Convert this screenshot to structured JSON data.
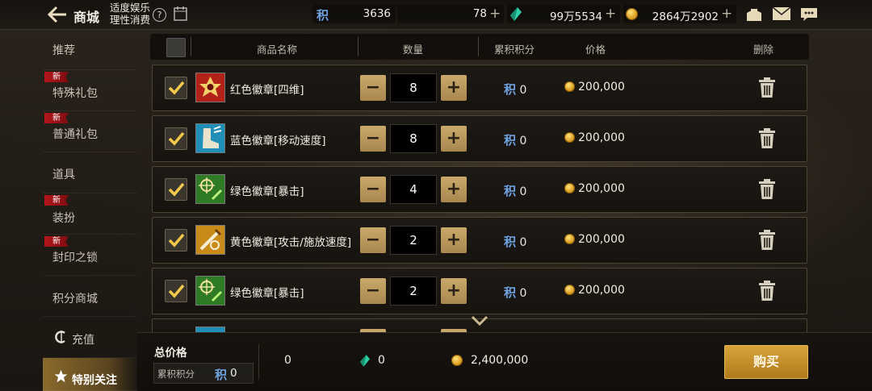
{
  "topbar": {
    "shop_title": "商城",
    "notice_line1": "适度娱乐",
    "notice_line2": "理性消费",
    "help_label": "?",
    "calendar_label": "关",
    "jifen_glyph": "积",
    "currencies": {
      "points": "3636",
      "c_glyph": "₵",
      "c_coins": "78",
      "gems": "99万5534",
      "gold": "2864万2902"
    },
    "plus_label": "+"
  },
  "sidebar": {
    "new_badge": "新",
    "items": [
      {
        "label": "推荐",
        "is_new": false,
        "active": false
      },
      {
        "label": "特殊礼包",
        "is_new": true,
        "active": false
      },
      {
        "label": "普通礼包",
        "is_new": true,
        "active": false
      },
      {
        "label": "道具",
        "is_new": false,
        "active": false
      },
      {
        "label": "装扮",
        "is_new": true,
        "active": false
      },
      {
        "label": "封印之锁",
        "is_new": true,
        "active": false
      },
      {
        "label": "积分商城",
        "is_new": false,
        "active": false
      },
      {
        "label": "充值",
        "is_new": false,
        "active": false,
        "icon": "c-coin-icon"
      },
      {
        "label": "特别关注",
        "is_new": false,
        "active": true,
        "icon": "star-icon"
      }
    ]
  },
  "table": {
    "headers": {
      "name": "商品名称",
      "quantity": "数量",
      "points": "累积积分",
      "price": "价格",
      "delete": "删除"
    },
    "minus_label": "−",
    "plus_label": "+",
    "rows": [
      {
        "name": "红色徽章[四维]",
        "qty": "8",
        "points": "0",
        "price": "200,000",
        "checked": true,
        "icon": "red-emblem-icon"
      },
      {
        "name": "蓝色徽章[移动速度]",
        "qty": "8",
        "points": "0",
        "price": "200,000",
        "checked": true,
        "icon": "blue-emblem-boot-icon"
      },
      {
        "name": "绿色徽章[暴击]",
        "qty": "4",
        "points": "0",
        "price": "200,000",
        "checked": true,
        "icon": "green-emblem-crosshair-icon"
      },
      {
        "name": "黄色徽章[攻击/施放速度]",
        "qty": "2",
        "points": "0",
        "price": "200,000",
        "checked": true,
        "icon": "yellow-emblem-sword-icon"
      },
      {
        "name": "绿色徽章[暴击]",
        "qty": "2",
        "points": "0",
        "price": "200,000",
        "checked": true,
        "icon": "green-emblem-crosshair-icon"
      }
    ]
  },
  "bottom": {
    "total_label": "总价格",
    "accumulated_label": "累积积分",
    "accumulated_value": "0",
    "total_c": "0",
    "total_gems": "0",
    "total_gold": "2,400,000",
    "buy_label": "购买"
  },
  "colors": {
    "accent_gold": "#d8a23a",
    "new_badge_red": "#b3161b",
    "jifen_blue": "#6fa2e0"
  }
}
